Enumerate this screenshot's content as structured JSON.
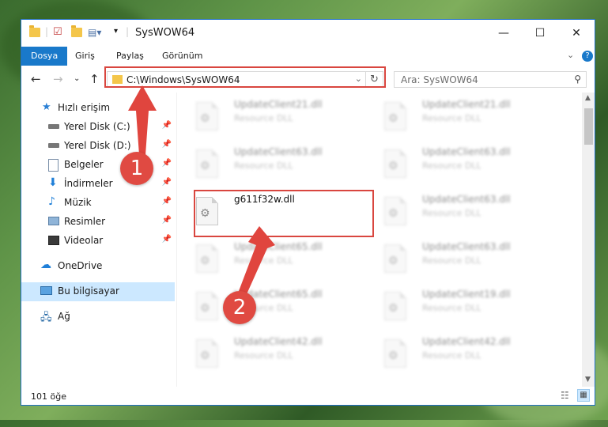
{
  "window": {
    "title": "SysWOW64",
    "controls": {
      "minimize": "—",
      "maximize": "☐",
      "close": "✕"
    }
  },
  "ribbon": {
    "tabs": [
      {
        "label": "Dosya",
        "active": true
      },
      {
        "label": "Giriş"
      },
      {
        "label": "Paylaş"
      },
      {
        "label": "Görünüm"
      }
    ]
  },
  "navigation": {
    "address": "C:\\Windows\\SysWOW64",
    "search_placeholder": "Ara: SysWOW64"
  },
  "sidebar": {
    "items": [
      {
        "label": "Hızlı erişim",
        "icon": "star-icon"
      },
      {
        "label": "Yerel Disk (C:)",
        "icon": "drive-icon",
        "pinned": true
      },
      {
        "label": "Yerel Disk (D:)",
        "icon": "drive-icon",
        "pinned": true
      },
      {
        "label": "Belgeler",
        "icon": "documents-icon",
        "pinned": true
      },
      {
        "label": "İndirmeler",
        "icon": "download-icon",
        "pinned": true
      },
      {
        "label": "Müzik",
        "icon": "music-icon",
        "pinned": true
      },
      {
        "label": "Resimler",
        "icon": "pictures-icon",
        "pinned": true
      },
      {
        "label": "Videolar",
        "icon": "videos-icon",
        "pinned": true
      },
      {
        "label": "OneDrive",
        "icon": "cloud-icon"
      },
      {
        "label": "Bu bilgisayar",
        "icon": "computer-icon",
        "selected": true
      },
      {
        "label": "Ağ",
        "icon": "network-icon"
      }
    ]
  },
  "files": [
    {
      "name": "UpdateClient21.dll",
      "type": "Resource DLL"
    },
    {
      "name": "UpdateClient21.dll",
      "type": "Resource DLL"
    },
    {
      "name": "UpdateClient63.dll",
      "type": "Resource DLL"
    },
    {
      "name": "UpdateClient63.dll",
      "type": "Resource DLL"
    },
    {
      "name": "g611f32w.dll",
      "type": "",
      "highlighted": true
    },
    {
      "name": "UpdateClient63.dll",
      "type": "Resource DLL"
    },
    {
      "name": "UpdateClient65.dll",
      "type": "Resource DLL"
    },
    {
      "name": "UpdateClient63.dll",
      "type": "Resource DLL"
    },
    {
      "name": "UpdateClient65.dll",
      "type": "Resource DLL"
    },
    {
      "name": "UpdateClient19.dll",
      "type": "Resource DLL"
    },
    {
      "name": "UpdateClient42.dll",
      "type": "Resource DLL"
    },
    {
      "name": "UpdateClient42.dll",
      "type": "Resource DLL"
    }
  ],
  "status": {
    "item_count": "101 öğe"
  },
  "annotations": {
    "step1": "1",
    "step2": "2"
  },
  "colors": {
    "accent": "#1979ca",
    "annotation": "#e0453e"
  }
}
